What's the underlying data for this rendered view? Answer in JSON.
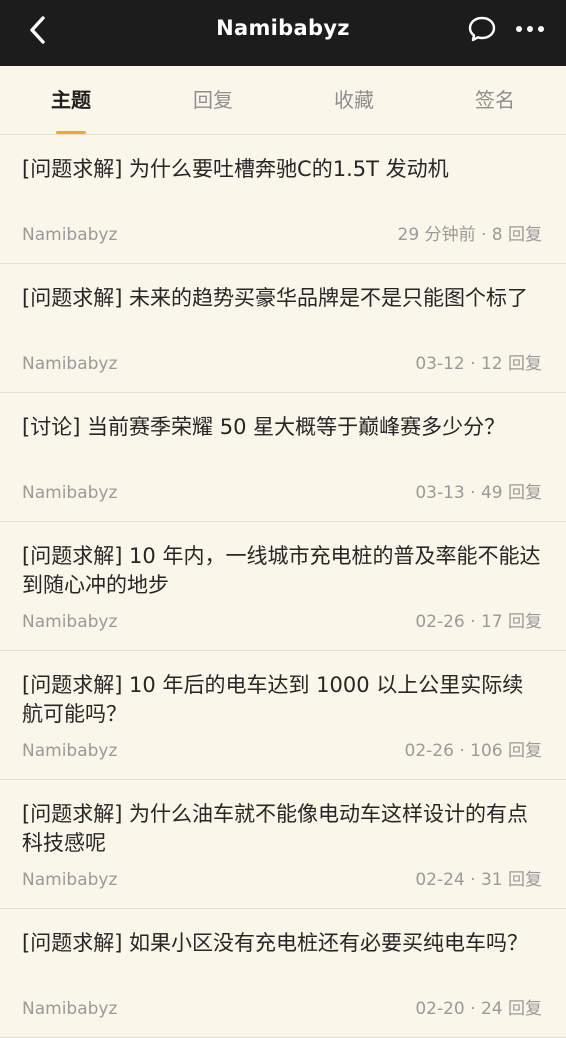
{
  "header": {
    "title": "Namibabyz",
    "icons": {
      "back": "chevron-left-icon",
      "chat": "chat-bubble-icon",
      "more": "more-dots-icon"
    }
  },
  "tabs": [
    {
      "label": "主题",
      "active": true
    },
    {
      "label": "回复",
      "active": false
    },
    {
      "label": "收藏",
      "active": false
    },
    {
      "label": "签名",
      "active": false
    }
  ],
  "colors": {
    "accent": "#f5a623",
    "topbar": "#1c1c1c",
    "background": "#fbf6ea"
  },
  "threads": [
    {
      "title": "[问题求解] 为什么要吐槽奔驰C的1.5T 发动机",
      "author": "Namibabyz",
      "meta": "29 分钟前 · 8 回复"
    },
    {
      "title": "[问题求解] 未来的趋势买豪华品牌是不是只能图个标了",
      "author": "Namibabyz",
      "meta": "03-12 · 12 回复"
    },
    {
      "title": "[讨论] 当前赛季荣耀 50 星大概等于巅峰赛多少分？",
      "author": "Namibabyz",
      "meta": "03-13 · 49 回复"
    },
    {
      "title": "[问题求解] 10 年内，一线城市充电桩的普及率能不能达到随心冲的地步",
      "author": "Namibabyz",
      "meta": "02-26 · 17 回复"
    },
    {
      "title": "[问题求解] 10 年后的电车达到 1000 以上公里实际续航可能吗？",
      "author": "Namibabyz",
      "meta": "02-26 · 106 回复"
    },
    {
      "title": "[问题求解] 为什么油车就不能像电动车这样设计的有点科技感呢",
      "author": "Namibabyz",
      "meta": "02-24 · 31 回复"
    },
    {
      "title": "[问题求解] 如果小区没有充电桩还有必要买纯电车吗？",
      "author": "Namibabyz",
      "meta": "02-20 · 24 回复"
    }
  ]
}
